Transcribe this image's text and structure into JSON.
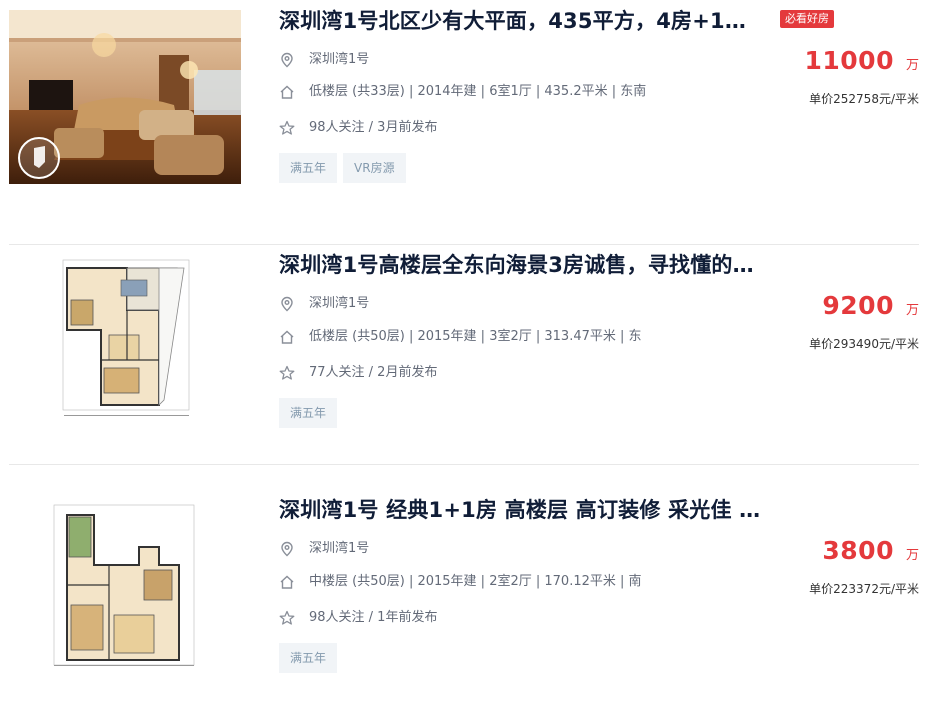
{
  "listings": [
    {
      "title": "深圳湾1号北区少有大平面，435平方，4房+1…",
      "badge": "必看好房",
      "community": "深圳湾1号",
      "house_info": "低楼层 (共33层) | 2014年建 | 6室1厅 | 435.2平米 | 东南",
      "follow_info": "98人关注 / 3月前发布",
      "tags": [
        "满五年",
        "VR房源"
      ],
      "total_price": "11000",
      "price_unit": "万",
      "unit_price": "单价252758元/平米"
    },
    {
      "title": "深圳湾1号高楼层全东向海景3房诚售，寻找懂的…",
      "community": "深圳湾1号",
      "house_info": "低楼层 (共50层) | 2015年建 | 3室2厅 | 313.47平米 | 东",
      "follow_info": "77人关注 / 2月前发布",
      "tags": [
        "满五年"
      ],
      "total_price": "9200",
      "price_unit": "万",
      "unit_price": "单价293490元/平米"
    },
    {
      "title": "深圳湾1号 经典1+1房 高楼层 高订装修 采光佳 …",
      "community": "深圳湾1号",
      "house_info": "中楼层 (共50层) | 2015年建 | 2室2厅 | 170.12平米 | 南",
      "follow_info": "98人关注 / 1年前发布",
      "tags": [
        "满五年"
      ],
      "total_price": "3800",
      "price_unit": "万",
      "unit_price": "单价223372元/平米"
    }
  ],
  "icons": {
    "location": "location-pin-icon",
    "house": "house-icon",
    "star": "star-icon",
    "vr": "vr-badge-icon"
  },
  "colors": {
    "price": "#e4393c",
    "title": "#101d37",
    "tag_bg": "#f1f4f7",
    "tag_text": "#849aae",
    "badge_bg": "#e4393c"
  }
}
